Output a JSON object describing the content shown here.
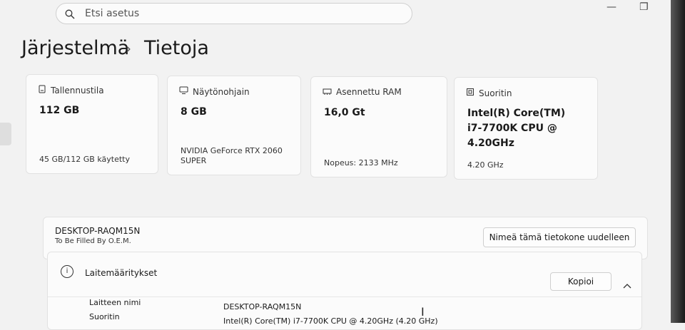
{
  "search": {
    "placeholder": "Etsi asetus"
  },
  "breadcrumb": {
    "parent": "Järjestelmä",
    "separator": "›",
    "current": "Tietoja"
  },
  "cards": [
    {
      "title": "Tallennustila",
      "value": "112 GB",
      "detail": "45 GB/112 GB käytetty",
      "icon": "storage-icon"
    },
    {
      "title": "Näytönohjain",
      "value": "8 GB",
      "detail": "NVIDIA GeForce RTX 2060 SUPER",
      "icon": "display-adapter-icon"
    },
    {
      "title": "Asennettu RAM",
      "value": "16,0 Gt",
      "detail": "Nopeus: 2133 MHz",
      "icon": "ram-icon"
    },
    {
      "title": "Suoritin",
      "value": "Intel(R) Core(TM) i7-7700K CPU @ 4.20GHz",
      "detail": "4.20 GHz",
      "icon": "processor-icon"
    }
  ],
  "device": {
    "name": "DESKTOP-RAQM15N",
    "manufacturer": "To Be Filled By O.E.M.",
    "rename_label": "Nimeä tämä tietokone uudelleen"
  },
  "specs": {
    "title": "Laitemääritykset",
    "copy_label": "Kopioi",
    "rows": [
      {
        "label": "Laitteen nimi",
        "value": "DESKTOP-RAQM15N"
      },
      {
        "label": "Suoritin",
        "value": "Intel(R) Core(TM) i7-7700K CPU @ 4.20GHz (4.20 GHz)"
      }
    ]
  },
  "window": {
    "minimize": "—",
    "maximize": "❐",
    "close": "✕"
  }
}
